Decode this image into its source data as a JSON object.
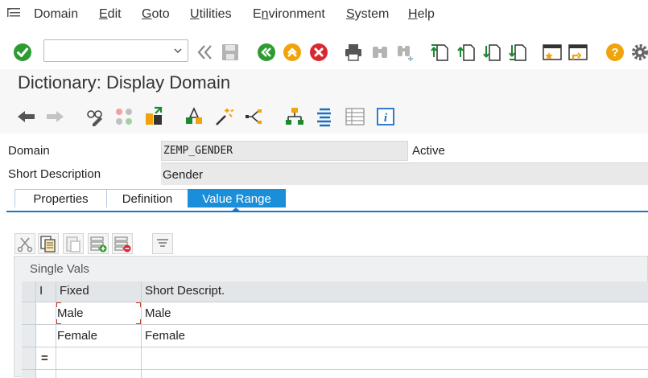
{
  "menu": {
    "items": [
      {
        "label": "Domain",
        "underline": ""
      },
      {
        "label": "Edit",
        "underline": "E"
      },
      {
        "label": "Goto",
        "underline": "G"
      },
      {
        "label": "Utilities",
        "underline": "U"
      },
      {
        "label": "Environment",
        "underline": "n"
      },
      {
        "label": "System",
        "underline": "S"
      },
      {
        "label": "Help",
        "underline": "H"
      }
    ]
  },
  "toolbar": {
    "command_value": "",
    "icons": [
      "enter-icon",
      "command-dropdown-icon",
      "collapse-icon",
      "save-icon",
      "back-icon",
      "exit-icon",
      "cancel-icon",
      "print-icon",
      "find-icon",
      "find-next-icon",
      "first-page-icon",
      "previous-page-icon",
      "next-page-icon",
      "last-page-icon",
      "new-session-icon",
      "create-shortcut-icon",
      "help-icon",
      "settings-icon"
    ]
  },
  "title": "Dictionary: Display Domain",
  "app_toolbar": {
    "icons": [
      "back-arrow-icon",
      "forward-arrow-icon",
      "display-change-icon",
      "other-object-icon",
      "activate-icon",
      "check-icon",
      "where-used-list-icon",
      "object-list-icon",
      "hierarchy-icon",
      "documentation-icon",
      "table-view-icon",
      "info-icon"
    ]
  },
  "header": {
    "domain_label": "Domain",
    "domain_value": "ZEMP_GENDER",
    "status": "Active",
    "short_description_label": "Short Description",
    "short_description_value": "Gender"
  },
  "tabs": {
    "properties": "Properties",
    "definition": "Definition",
    "value_range": "Value Range",
    "active": "Value Range"
  },
  "table_toolbar": {
    "icons": [
      "cut-icon",
      "copy-icon",
      "paste-icon",
      "insert-row-icon",
      "delete-row-icon",
      "filter-icon"
    ]
  },
  "single_vals": {
    "caption": "Single Vals",
    "columns": {
      "indicator": "I",
      "fixed": "Fixed",
      "short_description": "Short Descript."
    },
    "rows": [
      {
        "fixed": "Male",
        "short_description": "Male"
      },
      {
        "fixed": "Female",
        "short_description": "Female"
      }
    ],
    "row_marker_symbol": "="
  },
  "colors": {
    "accent": "#1a8ed8",
    "tab_line": "#1d74c9",
    "ok_green": "#2e9b32",
    "cancel_red": "#d9282f",
    "help_orange": "#f0a30a",
    "toolbar_green": "#1b8a2e"
  }
}
